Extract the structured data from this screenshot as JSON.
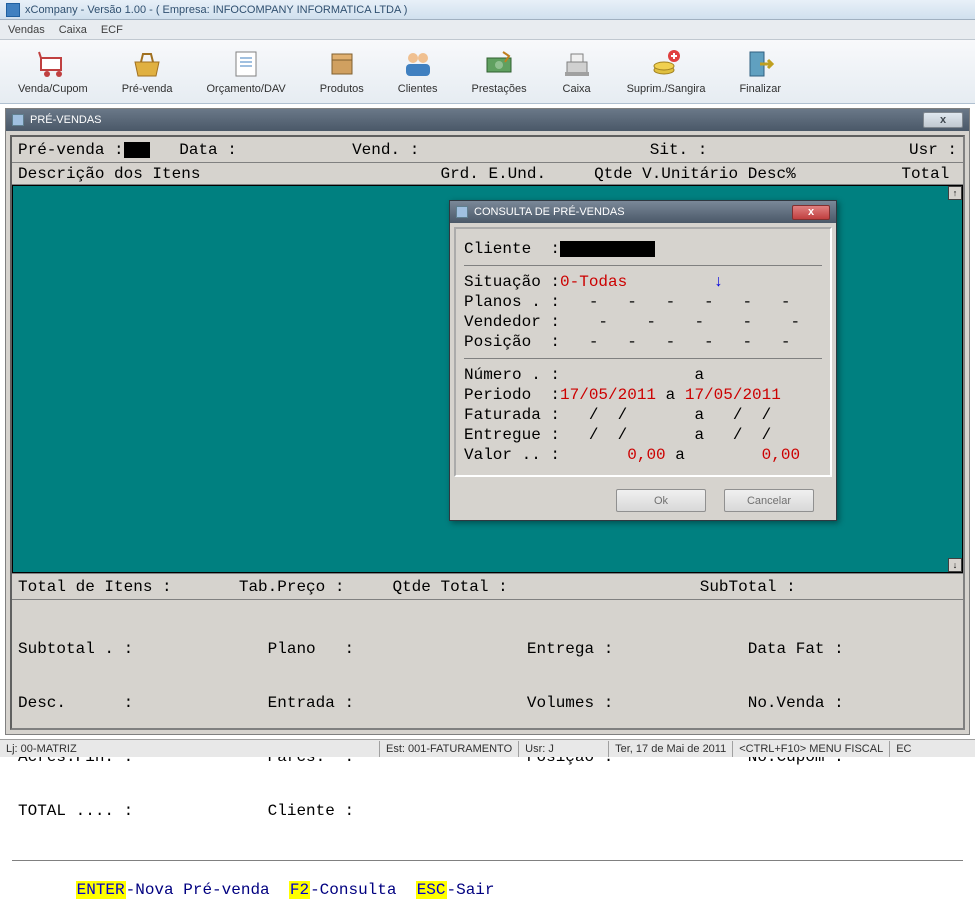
{
  "window_title": "xCompany - Versão 1.00  -  ( Empresa: INFOCOMPANY INFORMATICA LTDA )",
  "menubar": [
    "Vendas",
    "Caixa",
    "ECF"
  ],
  "toolbar": [
    {
      "label": "Venda/Cupom",
      "icon": "cart"
    },
    {
      "label": "Pré-venda",
      "icon": "basket"
    },
    {
      "label": "Orçamento/DAV",
      "icon": "doc"
    },
    {
      "label": "Produtos",
      "icon": "box"
    },
    {
      "label": "Clientes",
      "icon": "people"
    },
    {
      "label": "Prestações",
      "icon": "money"
    },
    {
      "label": "Caixa",
      "icon": "register"
    },
    {
      "label": "Suprim./Sangira",
      "icon": "coins"
    },
    {
      "label": "Finalizar",
      "icon": "exit"
    }
  ],
  "subwindow": {
    "title": "PRÉ-VENDAS",
    "header": {
      "pre_venda": "Pré-venda :",
      "data": "Data :",
      "vend": "Vend. :",
      "sit": "Sit. :",
      "usr": "Usr :"
    },
    "columns": "Descrição dos Itens                         Grd. E.Und.     Qtde V.Unitário Desc%           Total",
    "summary": "Total de Itens :       Tab.Preço :     Qtde Total :                    SubTotal :",
    "totals": {
      "l1": "Subtotal . :              Plano   :                  Entrega :              Data Fat :",
      "l2": "Desc.      :              Entrada :                  Volumes :              No.Venda :",
      "l3": "Acrés.Fin. :              Parcs.  :                  Posição :              No.Cupom :",
      "l4": "TOTAL .... :              Cliente :"
    },
    "hints": {
      "k1": "ENTER",
      "t1": "-Nova Pré-venda  ",
      "k2": "F2",
      "t2": "-Consulta  ",
      "k3": "ESC",
      "t3": "-Sair"
    }
  },
  "dialog": {
    "title": "CONSULTA DE PRÉ-VENDAS",
    "cliente_label": "Cliente  :",
    "rows": {
      "situacao_label": "Situação :",
      "situacao_value": "0-Todas",
      "planos": "Planos . :   -   -   -   -   -   -",
      "vendedor": "Vendedor :    -    -    -    -    -",
      "posicao": "Posição  :   -   -   -   -   -   -",
      "numero": "Número . :              a",
      "periodo_label": "Periodo  :",
      "periodo_from": "17/05/2011",
      "periodo_mid": " a ",
      "periodo_to": "17/05/2011",
      "faturada": "Faturada :   /  /       a   /  /",
      "entregue": "Entregue :   /  /       a   /  /",
      "valor_label": "Valor .. :",
      "valor_from": "0,00",
      "valor_mid": " a ",
      "valor_to": "0,00"
    },
    "ok": "Ok",
    "cancel": "Cancelar"
  },
  "statusbar": {
    "loja": "Lj: 00-MATRIZ",
    "est": "Est: 001-FATURAMENTO",
    "usr": "Usr: J",
    "date": "Ter, 17 de Mai de 2011",
    "hint": "<CTRL+F10> MENU FISCAL",
    "ec": "EC"
  }
}
